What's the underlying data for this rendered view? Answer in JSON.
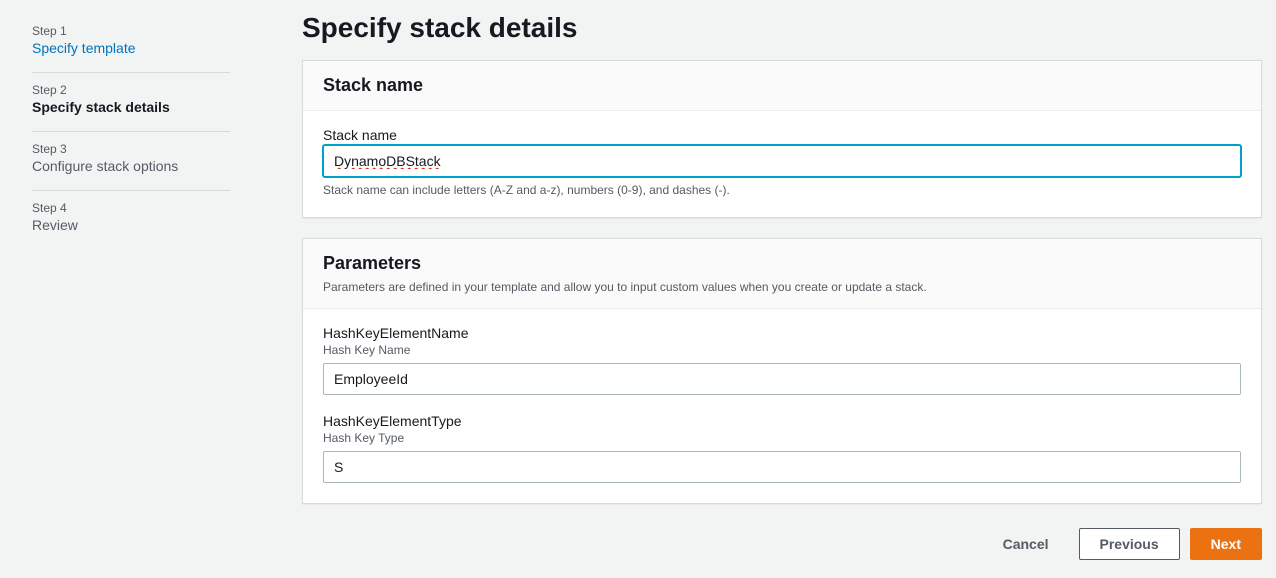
{
  "page": {
    "title": "Specify stack details"
  },
  "steps": [
    {
      "label": "Step 1",
      "title": "Specify template",
      "state": "link"
    },
    {
      "label": "Step 2",
      "title": "Specify stack details",
      "state": "current"
    },
    {
      "label": "Step 3",
      "title": "Configure stack options",
      "state": "upcoming"
    },
    {
      "label": "Step 4",
      "title": "Review",
      "state": "upcoming"
    }
  ],
  "stackNamePanel": {
    "header": "Stack name",
    "field": {
      "label": "Stack name",
      "value": "DynamoDBStack",
      "helper": "Stack name can include letters (A-Z and a-z), numbers (0-9), and dashes (-)."
    }
  },
  "parametersPanel": {
    "header": "Parameters",
    "subtitle": "Parameters are defined in your template and allow you to input custom values when you create or update a stack.",
    "fields": [
      {
        "label": "HashKeyElementName",
        "desc": "Hash Key Name",
        "value": "EmployeeId"
      },
      {
        "label": "HashKeyElementType",
        "desc": "Hash Key Type",
        "value": "S"
      }
    ]
  },
  "actions": {
    "cancel": "Cancel",
    "previous": "Previous",
    "next": "Next"
  }
}
